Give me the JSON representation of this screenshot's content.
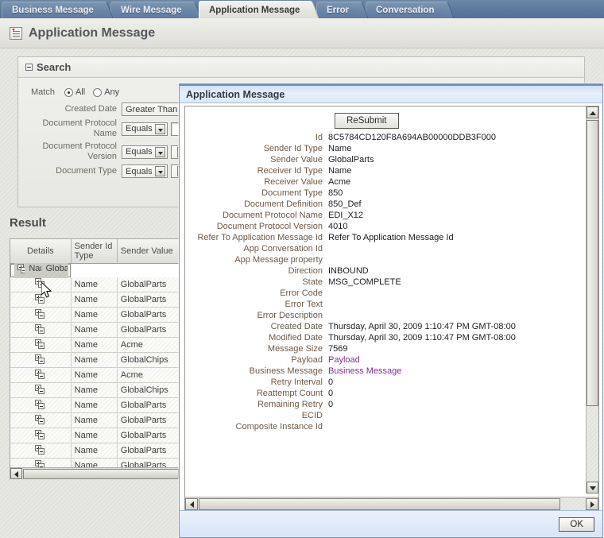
{
  "tabs": [
    {
      "label": "Business Message",
      "active": false
    },
    {
      "label": "Wire Message",
      "active": false
    },
    {
      "label": "Application Message",
      "active": true
    },
    {
      "label": "Error",
      "active": false
    },
    {
      "label": "Conversation",
      "active": false
    }
  ],
  "page": {
    "title": "Application Message",
    "icon": "document-list-icon"
  },
  "search": {
    "title": "Search",
    "match_label": "Match",
    "match_options": [
      "All",
      "Any"
    ],
    "match_selected": "All",
    "fields": [
      {
        "label": "Created Date",
        "operator": "Greater Than",
        "has_value_box": false,
        "has_value_select": false
      },
      {
        "label": "Document Protocol Name",
        "operator": "Equals",
        "has_value_box": true,
        "has_value_select": false
      },
      {
        "label": "Document Protocol Version",
        "operator": "Equals",
        "has_value_box": false,
        "has_value_select": true
      },
      {
        "label": "Document Type",
        "operator": "Equals",
        "has_value_box": false,
        "has_value_select": true
      }
    ]
  },
  "result": {
    "title": "Result",
    "columns": [
      "Details",
      "Sender Id Type",
      "Sender Value"
    ],
    "rows": [
      {
        "sender_id_type": "Name",
        "sender_value": "GlobalParts",
        "selected": true
      },
      {
        "sender_id_type": "Name",
        "sender_value": "GlobalParts",
        "selected": false
      },
      {
        "sender_id_type": "Name",
        "sender_value": "GlobalParts",
        "selected": false
      },
      {
        "sender_id_type": "Name",
        "sender_value": "GlobalParts",
        "selected": false
      },
      {
        "sender_id_type": "Name",
        "sender_value": "GlobalParts",
        "selected": false
      },
      {
        "sender_id_type": "Name",
        "sender_value": "Acme",
        "selected": false
      },
      {
        "sender_id_type": "Name",
        "sender_value": "GlobalChips",
        "selected": false
      },
      {
        "sender_id_type": "Name",
        "sender_value": "Acme",
        "selected": false
      },
      {
        "sender_id_type": "Name",
        "sender_value": "GlobalChips",
        "selected": false
      },
      {
        "sender_id_type": "Name",
        "sender_value": "GlobalParts",
        "selected": false
      },
      {
        "sender_id_type": "Name",
        "sender_value": "GlobalParts",
        "selected": false
      },
      {
        "sender_id_type": "Name",
        "sender_value": "GlobalParts",
        "selected": false
      },
      {
        "sender_id_type": "Name",
        "sender_value": "GlobalParts",
        "selected": false
      },
      {
        "sender_id_type": "Name",
        "sender_value": "GlobalParts",
        "selected": false
      }
    ]
  },
  "dialog": {
    "title": "Application Message",
    "resubmit_label": "ReSubmit",
    "ok_label": "OK",
    "fields": [
      {
        "label": "Id",
        "value": "8C5784CD120F8A694AB00000DDB3F000",
        "link": false
      },
      {
        "label": "Sender Id Type",
        "value": "Name",
        "link": false
      },
      {
        "label": "Sender Value",
        "value": "GlobalParts",
        "link": false
      },
      {
        "label": "Receiver Id Type",
        "value": "Name",
        "link": false
      },
      {
        "label": "Receiver Value",
        "value": "Acme",
        "link": false
      },
      {
        "label": "Document Type",
        "value": "850",
        "link": false
      },
      {
        "label": "Document Definition",
        "value": "850_Def",
        "link": false
      },
      {
        "label": "Document Protocol Name",
        "value": "EDI_X12",
        "link": false
      },
      {
        "label": "Document Protocol Version",
        "value": "4010",
        "link": false
      },
      {
        "label": "Refer To Application Message Id",
        "value": "Refer To Application Message Id",
        "link": false
      },
      {
        "label": "App Conversation Id",
        "value": "",
        "link": false
      },
      {
        "label": "App Message property",
        "value": "",
        "link": false
      },
      {
        "label": "Direction",
        "value": "INBOUND",
        "link": false
      },
      {
        "label": "State",
        "value": "MSG_COMPLETE",
        "link": false
      },
      {
        "label": "Error Code",
        "value": "",
        "link": false
      },
      {
        "label": "Error Text",
        "value": "",
        "link": false
      },
      {
        "label": "Error Description",
        "value": "",
        "link": false
      },
      {
        "label": "Created Date",
        "value": "Thursday, April 30, 2009 1:10:47 PM GMT-08:00",
        "link": false
      },
      {
        "label": "Modified Date",
        "value": "Thursday, April 30, 2009 1:10:47 PM GMT-08:00",
        "link": false
      },
      {
        "label": "Message Size",
        "value": "7569",
        "link": false
      },
      {
        "label": "Payload",
        "value": "Payload",
        "link": true
      },
      {
        "label": "Business Message",
        "value": "Business Message",
        "link": true
      },
      {
        "label": "Retry Interval",
        "value": "0",
        "link": false
      },
      {
        "label": "Reattempt Count",
        "value": "0",
        "link": false
      },
      {
        "label": "Remaining Retry",
        "value": "0",
        "link": false
      },
      {
        "label": "ECID",
        "value": "",
        "link": false
      },
      {
        "label": "Composite Instance Id",
        "value": "",
        "link": false
      }
    ]
  },
  "colors": {
    "tab_bar": "#5e7a9c",
    "active_tab": "#e4e4df",
    "dialog_title": "#dce9f8",
    "link": "#7a2f8a",
    "label": "#6d5a48"
  }
}
